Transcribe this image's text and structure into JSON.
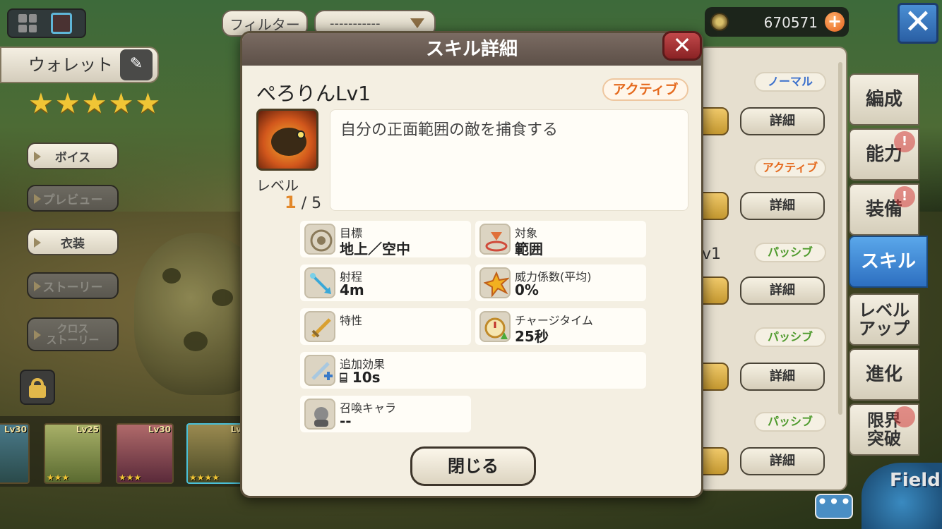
{
  "header": {
    "filter_label": "フィルター",
    "dropdown_value": "-----------",
    "currency": "670571"
  },
  "left": {
    "wallet_label": "ウォレット",
    "stars": "★★★★★",
    "buttons": [
      "ボイス",
      "プレビュー",
      "衣装",
      "ストーリー",
      "クロス\nストーリー"
    ]
  },
  "char_strip": [
    {
      "lv": "Lv30",
      "stars": "★★★"
    },
    {
      "lv": "Lv25",
      "stars": "★★★"
    },
    {
      "lv": "Lv30",
      "stars": "★★★"
    },
    {
      "lv": "Lv",
      "stars": "★★★★"
    }
  ],
  "right_panel": {
    "rows": [
      {
        "type": "ノーマル",
        "type_color": "#3a6fcc",
        "detail": "詳細"
      },
      {
        "type": "アクティブ",
        "type_color": "#e56a1e",
        "detail": "詳細"
      },
      {
        "type": "パッシブ",
        "type_color": "#4e9a2c",
        "detail": "詳細"
      },
      {
        "type": "パッシブ",
        "type_color": "#4e9a2c",
        "detail": "詳細"
      },
      {
        "type": "パッシブ",
        "type_color": "#4e9a2c",
        "detail": "詳細"
      }
    ],
    "lv_fragment": "v1"
  },
  "tabs": [
    {
      "label": "編成"
    },
    {
      "label": "能力"
    },
    {
      "label": "装備"
    },
    {
      "label": "スキル"
    },
    {
      "label": "レベル\nアップ"
    },
    {
      "label": "進化"
    },
    {
      "label": "限界\n突破"
    }
  ],
  "field_label": "Field",
  "chat_label": "•••",
  "dialog": {
    "title": "スキル詳細",
    "close_x": "✕",
    "skill_name": "ぺろりんLv1",
    "skill_type": "アクティブ",
    "level_label": "レベル",
    "level_current": "1",
    "level_max": "/ 5",
    "description": "自分の正面範囲の敵を捕食する",
    "stats": {
      "target_label": "目標",
      "target_value": "地上／空中",
      "scope_label": "対象",
      "scope_value": "範囲",
      "range_label": "射程",
      "range_value": "4m",
      "power_label": "威力係数(平均)",
      "power_value": "0%",
      "trait_label": "特性",
      "trait_value": "",
      "charge_label": "チャージタイム",
      "charge_value": "25秒",
      "extra_label": "追加効果",
      "extra_value": "10s",
      "summon_label": "召喚キャラ",
      "summon_value": "--"
    },
    "close_button": "閉じる"
  },
  "colors": {
    "accent_blue": "#2d6fc0",
    "active_orange": "#e56a1e",
    "dialog_header": "#6a5d55"
  }
}
